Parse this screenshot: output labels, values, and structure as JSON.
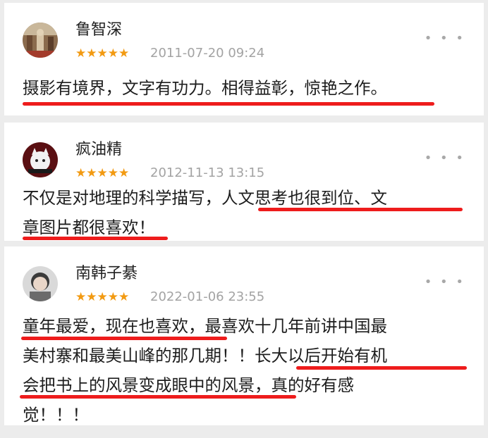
{
  "reviews": [
    {
      "name": "鲁智深",
      "stars": "★★★★★",
      "date": "2011-07-20 09:24",
      "lines": [
        "摄影有境界，文字有功力。相得益彰，惊艳之作。"
      ]
    },
    {
      "name": "疯油精",
      "stars": "★★★★★",
      "date": "2012-11-13 13:15",
      "lines": [
        "不仅是对地理的科学描写，人文思考也很到位、文",
        "章图片都很喜欢！"
      ]
    },
    {
      "name": "南韩子綦",
      "stars": "★★★★★",
      "date": "2022-01-06 23:55",
      "lines": [
        "童年最爱，现在也喜欢，最喜欢十几年前讲中国最",
        "美村寨和最美山峰的那几期！！长大以后开始有机",
        "会把书上的风景变成眼中的风景，真的好有感",
        "觉！！！"
      ]
    }
  ],
  "more_glyph": "• • •",
  "colors": {
    "star": "#f29a12",
    "underline": "#ee1c1c",
    "date": "#a3a3a3"
  }
}
